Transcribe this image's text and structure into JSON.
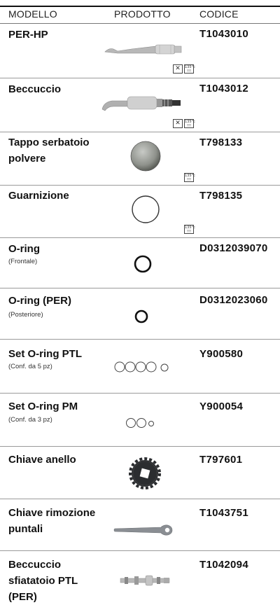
{
  "header": {
    "modello": "MODELLO",
    "prodotto": "PRODOTTO",
    "codice": "CODICE"
  },
  "badges": {
    "autoclave": "135°c\n!!!",
    "wash": "✕"
  },
  "rows": [
    {
      "name": "PER-HP",
      "sub": "",
      "code": "T1043010"
    },
    {
      "name": "Beccuccio",
      "sub": "",
      "code": "T1043012"
    },
    {
      "name": "Tappo serbatoio polvere",
      "sub": "",
      "code": "T798133"
    },
    {
      "name": "Guarnizione",
      "sub": "",
      "code": "T798135"
    },
    {
      "name": "O-ring",
      "sub": "(Frontale)",
      "code": "D0312039070"
    },
    {
      "name": "O-ring (PER)",
      "sub": "(Posteriore)",
      "code": "D0312023060"
    },
    {
      "name": "Set O-ring PTL",
      "sub": "(Conf. da 5 pz)",
      "code": "Y900580"
    },
    {
      "name": "Set O-ring PM",
      "sub": "(Conf. da 3 pz)",
      "code": "Y900054"
    },
    {
      "name": "Chiave anello",
      "sub": "",
      "code": "T797601"
    },
    {
      "name": "Chiave rimozione puntali",
      "sub": "",
      "code": "T1043751"
    },
    {
      "name": "Beccuccio sfiatatoio PTL (PER)",
      "sub": "",
      "code": "T1042094"
    }
  ]
}
